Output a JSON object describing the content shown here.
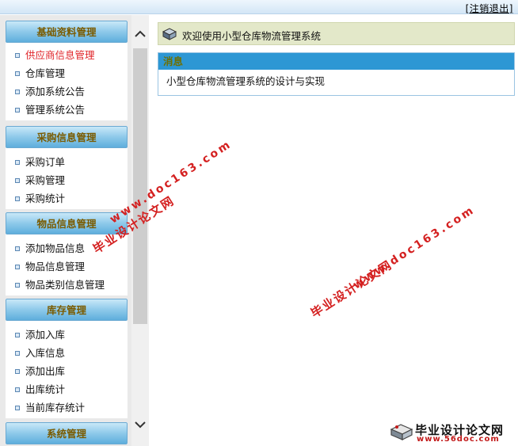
{
  "topbar": {
    "logout_label": "[注销退出]"
  },
  "menu": {
    "groups": [
      {
        "title": "基础资料管理",
        "items": [
          "供应商信息管理",
          "仓库管理",
          "添加系统公告",
          "管理系统公告"
        ]
      },
      {
        "title": "采购信息管理",
        "items": [
          "采购订单",
          "采购管理",
          "采购统计"
        ]
      },
      {
        "title": "物品信息管理",
        "items": [
          "添加物品信息",
          "物品信息管理",
          "物品类别信息管理"
        ]
      },
      {
        "title": "库存管理",
        "items": [
          "添加入库",
          "入库信息",
          "添加出库",
          "出库统计",
          "当前库存统计"
        ]
      },
      {
        "title": "系统管理",
        "items": []
      }
    ],
    "active_item": "供应商信息管理"
  },
  "main": {
    "welcome_text": "欢迎使用小型仓库物流管理系统",
    "news": {
      "header": "消息",
      "body": "小型仓库物流管理系统的设计与实现"
    }
  },
  "watermarks": {
    "cn": "毕业设计论文网",
    "url": "www.doc163.com",
    "corner_cn": "毕业设计论文网",
    "corner_url": "www.56doc.com"
  },
  "colors": {
    "accent": "#2d97d4",
    "active_menu": "#e0262b",
    "watermark": "#d42020",
    "welcome_bg": "#e3e8c9"
  }
}
